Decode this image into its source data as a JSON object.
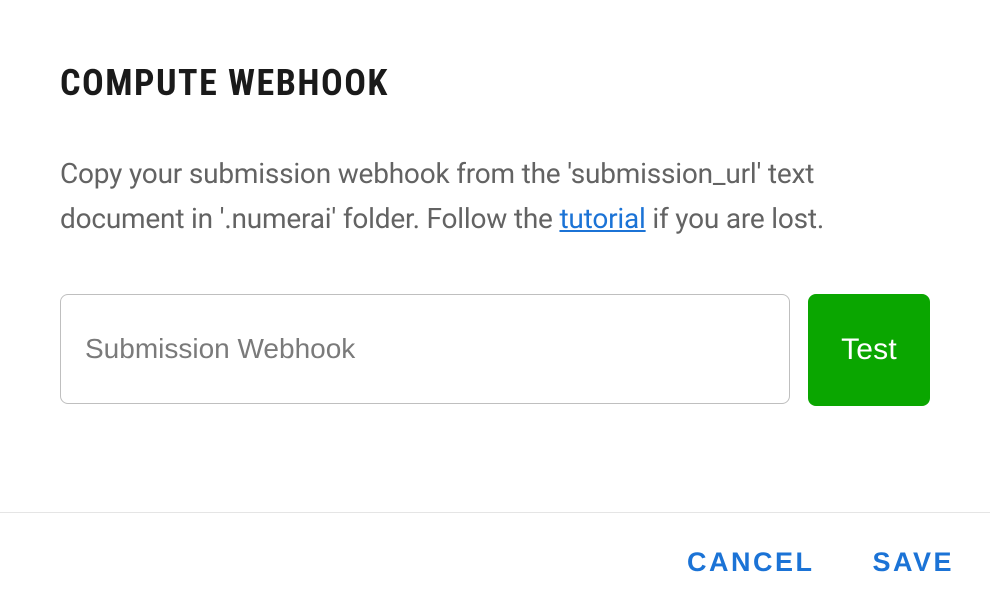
{
  "heading": "COMPUTE WEBHOOK",
  "description": {
    "prefix": "Copy your submission webhook from the 'submission_url' text document in '.numerai' folder. Follow the ",
    "link_text": "tutorial",
    "suffix": " if you are lost."
  },
  "input": {
    "placeholder": "Submission Webhook",
    "value": ""
  },
  "buttons": {
    "test": "Test",
    "cancel": "CANCEL",
    "save": "SAVE"
  }
}
